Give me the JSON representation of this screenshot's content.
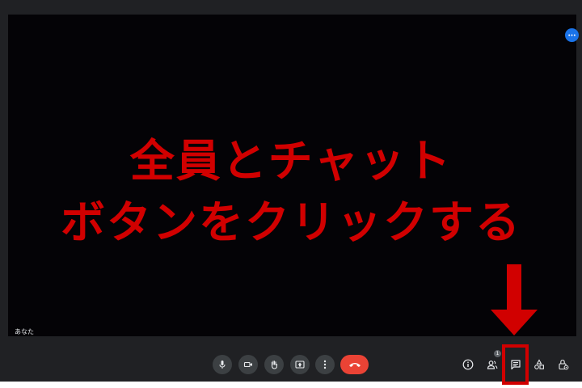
{
  "video": {
    "self_label": "あなた"
  },
  "overlay": {
    "line1": "全員とチャット",
    "line2": "ボタンをクリックする",
    "color": "#d10000"
  },
  "participants": {
    "count": "1"
  },
  "controls": {
    "icons": [
      "mic-icon",
      "camera-icon",
      "raise-hand-icon",
      "present-screen-icon",
      "more-options-icon",
      "hang-up-icon"
    ]
  },
  "side_controls": {
    "icons": [
      "info-icon",
      "people-icon",
      "chat-icon",
      "activities-icon",
      "host-controls-icon"
    ]
  },
  "colors": {
    "background": "#202124",
    "tile": "#040306",
    "hangup": "#ea4335",
    "accent": "#1a73e8"
  }
}
